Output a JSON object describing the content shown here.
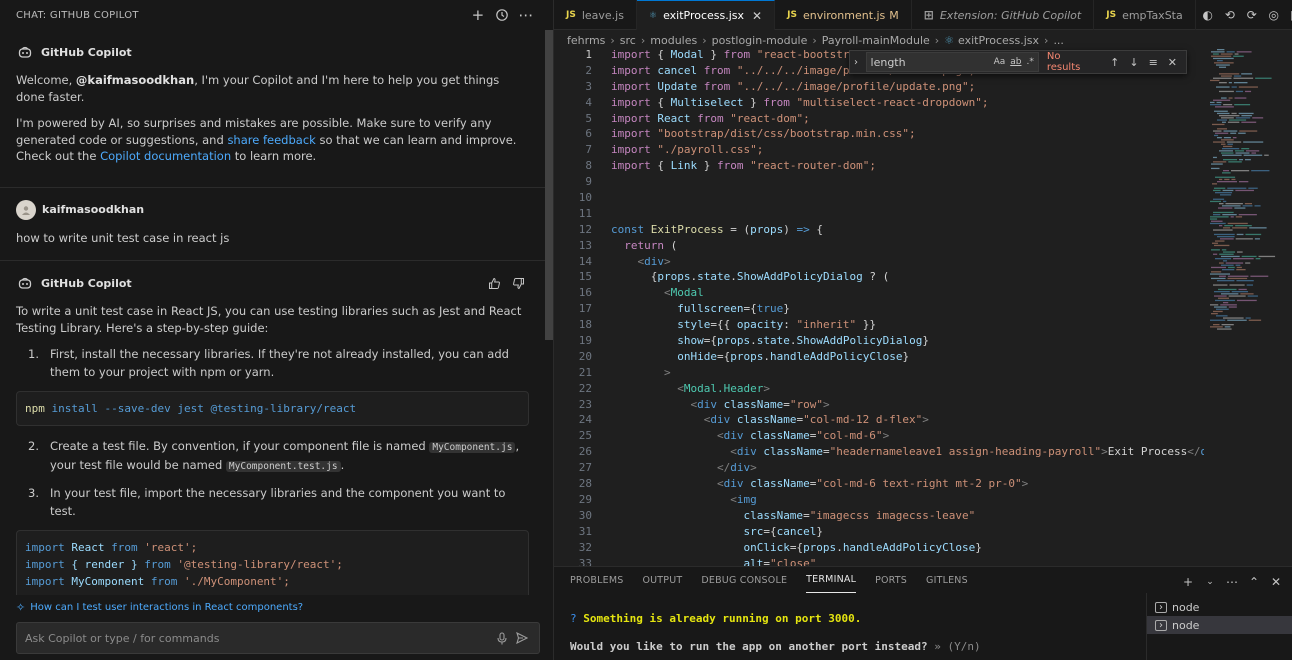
{
  "chat": {
    "header_title": "CHAT: GITHUB COPILOT",
    "welcome": {
      "author": "GitHub Copilot",
      "line1_pre": "Welcome, ",
      "user_handle": "@kaifmasoodkhan",
      "line1_post": ", I'm your Copilot and I'm here to help you get things done faster.",
      "line2_pre": "I'm powered by AI, so surprises and mistakes are possible. Make sure to verify any generated code or suggestions, and ",
      "share_feedback": "share feedback",
      "line2_mid": " so that we can learn and improve. Check out the ",
      "copilot_docs": "Copilot documentation",
      "line2_post": " to learn more."
    },
    "user_msg": {
      "author": "kaifmasoodkhan",
      "text": "how to write unit test case in react js"
    },
    "answer": {
      "author": "GitHub Copilot",
      "intro": "To write a unit test case in React JS, you can use testing libraries such as Jest and React Testing Library. Here's a step-by-step guide:",
      "step1_num": "1.",
      "step1": "First, install the necessary libraries. If they're not already installed, you can add them to your project with npm or yarn.",
      "code1": {
        "cmd": "npm",
        "args": " install --save-dev jest @testing-library/react"
      },
      "step2_num": "2.",
      "step2_pre": "Create a test file. By convention, if your component file is named ",
      "step2_code1": "MyComponent.js",
      "step2_mid": ", your test file would be named ",
      "step2_code2": "MyComponent.test.js",
      "step2_post": ".",
      "step3_num": "3.",
      "step3": "In your test file, import the necessary libraries and the component you want to test.",
      "code2": {
        "l1_kw": "import",
        "l1_name": " React ",
        "l1_from": "from",
        "l1_str": " 'react';",
        "l2_kw": "import",
        "l2_name": " { render } ",
        "l2_from": "from",
        "l2_str": " '@testing-library/react';",
        "l3_kw": "import",
        "l3_name": " MyComponent ",
        "l3_from": "from",
        "l3_str": " './MyComponent';"
      }
    },
    "suggestion": "How can I test user interactions in React components?",
    "input_placeholder": "Ask Copilot or type / for commands"
  },
  "editor": {
    "tabs": [
      {
        "icon": "JS",
        "label": "leave.js",
        "modified": "",
        "active": false
      },
      {
        "icon": "⚛",
        "label": "exitProcess.jsx",
        "modified": "",
        "active": true
      },
      {
        "icon": "JS",
        "label": "environment.js",
        "modified": "M",
        "active": false
      },
      {
        "icon": "⊞",
        "label": "Extension: GitHub Copilot",
        "modified": "",
        "active": false
      },
      {
        "icon": "JS",
        "label": "empTaxSta",
        "modified": "",
        "active": false
      }
    ],
    "breadcrumb": [
      "fehrms",
      "src",
      "modules",
      "postlogin-module",
      "Payroll-mainModule",
      "exitProcess.jsx",
      "..."
    ],
    "find": {
      "query": "length",
      "opt_case": "Aa",
      "opt_word": "ab",
      "opt_regex": ".*",
      "status": "No results"
    },
    "code_lines": [
      [
        [
          "kw",
          "import"
        ],
        [
          "pun",
          " { "
        ],
        [
          "var",
          "Modal"
        ],
        [
          "pun",
          " } "
        ],
        [
          "kw",
          "from"
        ],
        [
          "str",
          " \"react-bootstrap\";"
        ]
      ],
      [
        [
          "kw",
          "import"
        ],
        [
          "var",
          " cancel "
        ],
        [
          "kw",
          "from"
        ],
        [
          "str",
          " \"../../../image/profile/cancel.png\";"
        ]
      ],
      [
        [
          "kw",
          "import"
        ],
        [
          "var",
          " Update "
        ],
        [
          "kw",
          "from"
        ],
        [
          "str",
          " \"../../../image/profile/update.png\";"
        ]
      ],
      [
        [
          "kw",
          "import"
        ],
        [
          "pun",
          " { "
        ],
        [
          "var",
          "Multiselect"
        ],
        [
          "pun",
          " } "
        ],
        [
          "kw",
          "from"
        ],
        [
          "str",
          " \"multiselect-react-dropdown\";"
        ]
      ],
      [
        [
          "kw",
          "import"
        ],
        [
          "var",
          " React "
        ],
        [
          "kw",
          "from"
        ],
        [
          "str",
          " \"react-dom\";"
        ]
      ],
      [
        [
          "kw",
          "import"
        ],
        [
          "str",
          " \"bootstrap/dist/css/bootstrap.min.css\";"
        ]
      ],
      [
        [
          "kw",
          "import"
        ],
        [
          "str",
          " \"./payroll.css\";"
        ]
      ],
      [
        [
          "kw",
          "import"
        ],
        [
          "pun",
          " { "
        ],
        [
          "var",
          "Link"
        ],
        [
          "pun",
          " } "
        ],
        [
          "kw",
          "from"
        ],
        [
          "str",
          " \"react-router-dom\";"
        ]
      ],
      [],
      [],
      [],
      [
        [
          "kw2",
          "const"
        ],
        [
          "fn",
          " ExitProcess"
        ],
        [
          "pun",
          " = ("
        ],
        [
          "var",
          "props"
        ],
        [
          "pun",
          ") "
        ],
        [
          "kw2",
          "=>"
        ],
        [
          "pun",
          " {"
        ]
      ],
      [
        [
          "pun",
          "  "
        ],
        [
          "kw",
          "return"
        ],
        [
          "pun",
          " ("
        ]
      ],
      [
        [
          "pun",
          "    "
        ],
        [
          "jsxbr",
          "<"
        ],
        [
          "kw2",
          "div"
        ],
        [
          "jsxbr",
          ">"
        ]
      ],
      [
        [
          "pun",
          "      {"
        ],
        [
          "var",
          "props"
        ],
        [
          "pun",
          "."
        ],
        [
          "var",
          "state"
        ],
        [
          "pun",
          "."
        ],
        [
          "var",
          "ShowAddPolicyDialog"
        ],
        [
          "pun",
          " ? ("
        ]
      ],
      [
        [
          "pun",
          "        "
        ],
        [
          "jsxbr",
          "<"
        ],
        [
          "tag",
          "Modal"
        ]
      ],
      [
        [
          "pun",
          "          "
        ],
        [
          "var",
          "fullscreen"
        ],
        [
          "pun",
          "={"
        ],
        [
          "kw2",
          "true"
        ],
        [
          "pun",
          "}"
        ]
      ],
      [
        [
          "pun",
          "          "
        ],
        [
          "var",
          "style"
        ],
        [
          "pun",
          "={{ "
        ],
        [
          "var",
          "opacity"
        ],
        [
          "pun",
          ": "
        ],
        [
          "str",
          "\"inherit\""
        ],
        [
          "pun",
          " }}"
        ]
      ],
      [
        [
          "pun",
          "          "
        ],
        [
          "var",
          "show"
        ],
        [
          "pun",
          "={"
        ],
        [
          "var",
          "props"
        ],
        [
          "pun",
          "."
        ],
        [
          "var",
          "state"
        ],
        [
          "pun",
          "."
        ],
        [
          "var",
          "ShowAddPolicyDialog"
        ],
        [
          "pun",
          "}"
        ]
      ],
      [
        [
          "pun",
          "          "
        ],
        [
          "var",
          "onHide"
        ],
        [
          "pun",
          "={"
        ],
        [
          "var",
          "props"
        ],
        [
          "pun",
          "."
        ],
        [
          "var",
          "handleAddPolicyClose"
        ],
        [
          "pun",
          "}"
        ]
      ],
      [
        [
          "pun",
          "        "
        ],
        [
          "jsxbr",
          ">"
        ]
      ],
      [
        [
          "pun",
          "          "
        ],
        [
          "jsxbr",
          "<"
        ],
        [
          "tag",
          "Modal.Header"
        ],
        [
          "jsxbr",
          ">"
        ]
      ],
      [
        [
          "pun",
          "            "
        ],
        [
          "jsxbr",
          "<"
        ],
        [
          "kw2",
          "div"
        ],
        [
          "var",
          " className"
        ],
        [
          "pun",
          "="
        ],
        [
          "str",
          "\"row\""
        ],
        [
          "jsxbr",
          ">"
        ]
      ],
      [
        [
          "pun",
          "              "
        ],
        [
          "jsxbr",
          "<"
        ],
        [
          "kw2",
          "div"
        ],
        [
          "var",
          " className"
        ],
        [
          "pun",
          "="
        ],
        [
          "str",
          "\"col-md-12 d-flex\""
        ],
        [
          "jsxbr",
          ">"
        ]
      ],
      [
        [
          "pun",
          "                "
        ],
        [
          "jsxbr",
          "<"
        ],
        [
          "kw2",
          "div"
        ],
        [
          "var",
          " className"
        ],
        [
          "pun",
          "="
        ],
        [
          "str",
          "\"col-md-6\""
        ],
        [
          "jsxbr",
          ">"
        ]
      ],
      [
        [
          "pun",
          "                  "
        ],
        [
          "jsxbr",
          "<"
        ],
        [
          "kw2",
          "div"
        ],
        [
          "var",
          " className"
        ],
        [
          "pun",
          "="
        ],
        [
          "str",
          "\"headernameleave1 assign-heading-payroll\""
        ],
        [
          "jsxbr",
          ">"
        ],
        [
          "pun",
          "Exit Process"
        ],
        [
          "jsxbr",
          "</"
        ],
        [
          "kw2",
          "div"
        ]
      ],
      [
        [
          "pun",
          "                "
        ],
        [
          "jsxbr",
          "</"
        ],
        [
          "kw2",
          "div"
        ],
        [
          "jsxbr",
          ">"
        ]
      ],
      [
        [
          "pun",
          "                "
        ],
        [
          "jsxbr",
          "<"
        ],
        [
          "kw2",
          "div"
        ],
        [
          "var",
          " className"
        ],
        [
          "pun",
          "="
        ],
        [
          "str",
          "\"col-md-6 text-right mt-2 pr-0\""
        ],
        [
          "jsxbr",
          ">"
        ]
      ],
      [
        [
          "pun",
          "                  "
        ],
        [
          "jsxbr",
          "<"
        ],
        [
          "kw2",
          "img"
        ]
      ],
      [
        [
          "pun",
          "                    "
        ],
        [
          "var",
          "className"
        ],
        [
          "pun",
          "="
        ],
        [
          "str",
          "\"imagecss imagecss-leave\""
        ]
      ],
      [
        [
          "pun",
          "                    "
        ],
        [
          "var",
          "src"
        ],
        [
          "pun",
          "={"
        ],
        [
          "var",
          "cancel"
        ],
        [
          "pun",
          "}"
        ]
      ],
      [
        [
          "pun",
          "                    "
        ],
        [
          "var",
          "onClick"
        ],
        [
          "pun",
          "={"
        ],
        [
          "var",
          "props"
        ],
        [
          "pun",
          "."
        ],
        [
          "var",
          "handleAddPolicyClose"
        ],
        [
          "pun",
          "}"
        ]
      ],
      [
        [
          "pun",
          "                    "
        ],
        [
          "var",
          "alt"
        ],
        [
          "pun",
          "="
        ],
        [
          "str",
          "\"close\""
        ]
      ]
    ]
  },
  "panel": {
    "tabs": [
      {
        "label": "PROBLEMS",
        "active": false
      },
      {
        "label": "OUTPUT",
        "active": false
      },
      {
        "label": "DEBUG CONSOLE",
        "active": false
      },
      {
        "label": "TERMINAL",
        "active": true
      },
      {
        "label": "PORTS",
        "active": false
      },
      {
        "label": "GITLENS",
        "active": false
      }
    ],
    "terminal": {
      "q_mark": "?",
      "line1": " Something is already running on port 3000.",
      "line2": "Would you like to run the app on another port instead?",
      "line2_hint": " » (Y/n)"
    },
    "terminals": [
      "node",
      "node"
    ]
  }
}
